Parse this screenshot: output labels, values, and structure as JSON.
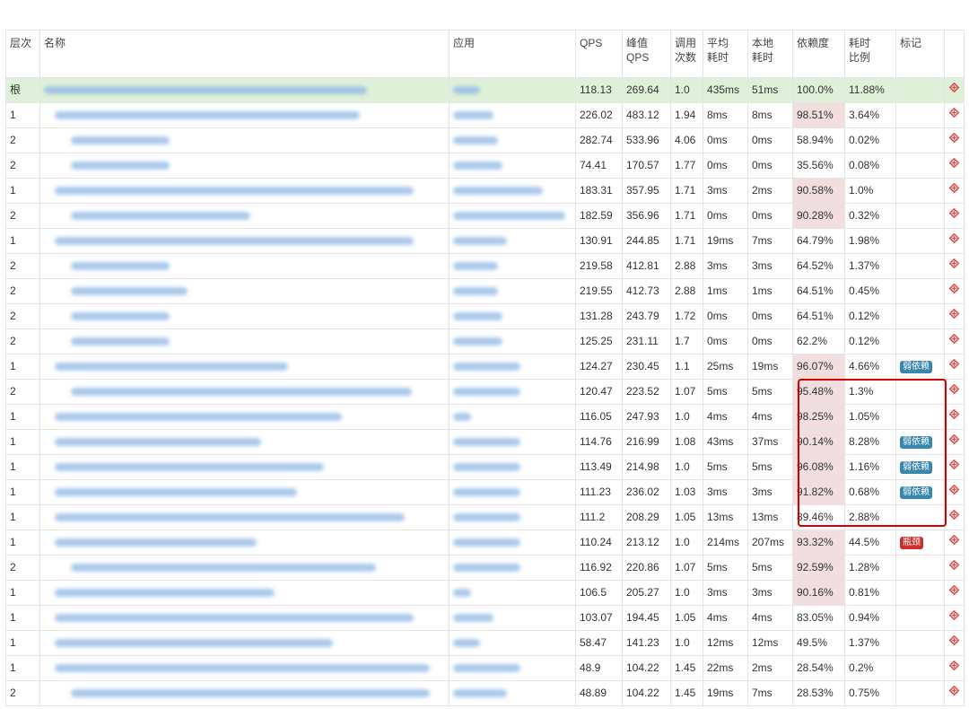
{
  "columns": [
    "层次",
    "名称",
    "应用",
    "QPS",
    "峰值QPS",
    "调用次数",
    "平均耗时",
    "本地耗时",
    "依赖度",
    "耗时比例",
    "标记",
    ""
  ],
  "header_lines": {
    "level": "层次",
    "name": "名称",
    "app": "应用",
    "qps": "QPS",
    "peak_1": "峰值",
    "peak_2": "QPS",
    "calls_1": "调用",
    "calls_2": "次数",
    "avg_1": "平均",
    "avg_2": "耗时",
    "local_1": "本地",
    "local_2": "耗时",
    "dep": "依赖度",
    "ratio_1": "耗时",
    "ratio_2": "比例",
    "mark": "标记"
  },
  "rows": [
    {
      "level": "根",
      "indent": 0,
      "name_w": 360,
      "app_w": 30,
      "qps": "118.13",
      "peak": "269.64",
      "calls": "1.0",
      "avg": "435ms",
      "local": "51ms",
      "dep": "100.0%",
      "ratio": "11.88%",
      "mark": "",
      "root": true
    },
    {
      "level": "1",
      "indent": 1,
      "name_w": 340,
      "app_w": 45,
      "qps": "226.02",
      "peak": "483.12",
      "calls": "1.94",
      "avg": "8ms",
      "local": "8ms",
      "dep": "98.51%",
      "ratio": "3.64%",
      "mark": "",
      "hl": true
    },
    {
      "level": "2",
      "indent": 2,
      "name_w": 110,
      "app_w": 50,
      "qps": "282.74",
      "peak": "533.96",
      "calls": "4.06",
      "avg": "0ms",
      "local": "0ms",
      "dep": "58.94%",
      "ratio": "0.02%",
      "mark": ""
    },
    {
      "level": "2",
      "indent": 2,
      "name_w": 110,
      "app_w": 55,
      "qps": "74.41",
      "peak": "170.57",
      "calls": "1.77",
      "avg": "0ms",
      "local": "0ms",
      "dep": "35.56%",
      "ratio": "0.08%",
      "mark": ""
    },
    {
      "level": "1",
      "indent": 1,
      "name_w": 400,
      "app_w": 100,
      "qps": "183.31",
      "peak": "357.95",
      "calls": "1.71",
      "avg": "3ms",
      "local": "2ms",
      "dep": "90.58%",
      "ratio": "1.0%",
      "mark": "",
      "hl": true
    },
    {
      "level": "2",
      "indent": 2,
      "name_w": 200,
      "app_w": 125,
      "qps": "182.59",
      "peak": "356.96",
      "calls": "1.71",
      "avg": "0ms",
      "local": "0ms",
      "dep": "90.28%",
      "ratio": "0.32%",
      "mark": "",
      "hl": true
    },
    {
      "level": "1",
      "indent": 1,
      "name_w": 400,
      "app_w": 60,
      "qps": "130.91",
      "peak": "244.85",
      "calls": "1.71",
      "avg": "19ms",
      "local": "7ms",
      "dep": "64.79%",
      "ratio": "1.98%",
      "mark": ""
    },
    {
      "level": "2",
      "indent": 2,
      "name_w": 110,
      "app_w": 50,
      "qps": "219.58",
      "peak": "412.81",
      "calls": "2.88",
      "avg": "3ms",
      "local": "3ms",
      "dep": "64.52%",
      "ratio": "1.37%",
      "mark": ""
    },
    {
      "level": "2",
      "indent": 2,
      "name_w": 130,
      "app_w": 50,
      "qps": "219.55",
      "peak": "412.73",
      "calls": "2.88",
      "avg": "1ms",
      "local": "1ms",
      "dep": "64.51%",
      "ratio": "0.45%",
      "mark": ""
    },
    {
      "level": "2",
      "indent": 2,
      "name_w": 110,
      "app_w": 55,
      "qps": "131.28",
      "peak": "243.79",
      "calls": "1.72",
      "avg": "0ms",
      "local": "0ms",
      "dep": "64.51%",
      "ratio": "0.12%",
      "mark": ""
    },
    {
      "level": "2",
      "indent": 2,
      "name_w": 110,
      "app_w": 55,
      "qps": "125.25",
      "peak": "231.11",
      "calls": "1.7",
      "avg": "0ms",
      "local": "0ms",
      "dep": "62.2%",
      "ratio": "0.12%",
      "mark": ""
    },
    {
      "level": "1",
      "indent": 1,
      "name_w": 260,
      "app_w": 75,
      "qps": "124.27",
      "peak": "230.45",
      "calls": "1.1",
      "avg": "25ms",
      "local": "19ms",
      "dep": "96.07%",
      "ratio": "4.66%",
      "mark": "弱依赖",
      "mark_type": "weak",
      "hl": true
    },
    {
      "level": "2",
      "indent": 2,
      "name_w": 380,
      "app_w": 75,
      "qps": "120.47",
      "peak": "223.52",
      "calls": "1.07",
      "avg": "5ms",
      "local": "5ms",
      "dep": "95.48%",
      "ratio": "1.3%",
      "mark": "",
      "hl": true
    },
    {
      "level": "1",
      "indent": 1,
      "name_w": 320,
      "app_w": 20,
      "qps": "116.05",
      "peak": "247.93",
      "calls": "1.0",
      "avg": "4ms",
      "local": "4ms",
      "dep": "98.25%",
      "ratio": "1.05%",
      "mark": "",
      "hl": true
    },
    {
      "level": "1",
      "indent": 1,
      "name_w": 230,
      "app_w": 75,
      "qps": "114.76",
      "peak": "216.99",
      "calls": "1.08",
      "avg": "43ms",
      "local": "37ms",
      "dep": "90.14%",
      "ratio": "8.28%",
      "mark": "弱依赖",
      "mark_type": "weak",
      "hl": true
    },
    {
      "level": "1",
      "indent": 1,
      "name_w": 300,
      "app_w": 75,
      "qps": "113.49",
      "peak": "214.98",
      "calls": "1.0",
      "avg": "5ms",
      "local": "5ms",
      "dep": "96.08%",
      "ratio": "1.16%",
      "mark": "弱依赖",
      "mark_type": "weak",
      "hl": true
    },
    {
      "level": "1",
      "indent": 1,
      "name_w": 270,
      "app_w": 75,
      "qps": "111.23",
      "peak": "236.02",
      "calls": "1.03",
      "avg": "3ms",
      "local": "3ms",
      "dep": "91.82%",
      "ratio": "0.68%",
      "mark": "弱依赖",
      "mark_type": "weak",
      "hl": true
    },
    {
      "level": "1",
      "indent": 1,
      "name_w": 390,
      "app_w": 75,
      "qps": "111.2",
      "peak": "208.29",
      "calls": "1.05",
      "avg": "13ms",
      "local": "13ms",
      "dep": "89.46%",
      "ratio": "2.88%",
      "mark": ""
    },
    {
      "level": "1",
      "indent": 1,
      "name_w": 225,
      "app_w": 75,
      "qps": "110.24",
      "peak": "213.12",
      "calls": "1.0",
      "avg": "214ms",
      "local": "207ms",
      "dep": "93.32%",
      "ratio": "44.5%",
      "mark": "瓶颈",
      "mark_type": "bottleneck",
      "hl": true
    },
    {
      "level": "2",
      "indent": 2,
      "name_w": 340,
      "app_w": 75,
      "qps": "116.92",
      "peak": "220.86",
      "calls": "1.07",
      "avg": "5ms",
      "local": "5ms",
      "dep": "92.59%",
      "ratio": "1.28%",
      "mark": "",
      "hl": true
    },
    {
      "level": "1",
      "indent": 1,
      "name_w": 245,
      "app_w": 20,
      "qps": "106.5",
      "peak": "205.27",
      "calls": "1.0",
      "avg": "3ms",
      "local": "3ms",
      "dep": "90.16%",
      "ratio": "0.81%",
      "mark": "",
      "hl": true
    },
    {
      "level": "1",
      "indent": 1,
      "name_w": 400,
      "app_w": 45,
      "qps": "103.07",
      "peak": "194.45",
      "calls": "1.05",
      "avg": "4ms",
      "local": "4ms",
      "dep": "83.05%",
      "ratio": "0.94%",
      "mark": ""
    },
    {
      "level": "1",
      "indent": 1,
      "name_w": 310,
      "app_w": 30,
      "qps": "58.47",
      "peak": "141.23",
      "calls": "1.0",
      "avg": "12ms",
      "local": "12ms",
      "dep": "49.5%",
      "ratio": "1.37%",
      "mark": ""
    },
    {
      "level": "1",
      "indent": 1,
      "name_w": 430,
      "app_w": 75,
      "qps": "48.9",
      "peak": "104.22",
      "calls": "1.45",
      "avg": "22ms",
      "local": "2ms",
      "dep": "28.54%",
      "ratio": "0.2%",
      "mark": ""
    },
    {
      "level": "2",
      "indent": 2,
      "name_w": 400,
      "app_w": 60,
      "qps": "48.89",
      "peak": "104.22",
      "calls": "1.45",
      "avg": "19ms",
      "local": "7ms",
      "dep": "28.53%",
      "ratio": "0.75%",
      "mark": ""
    }
  ],
  "icons": {
    "row_action": "crosshair-diamond-icon"
  },
  "colors": {
    "root_row": "#dff0d8",
    "dependency_highlight": "#f2dede",
    "weak_badge": "#3a87ad",
    "bottleneck_badge": "#c9302c",
    "annotation_box": "#d40000"
  }
}
